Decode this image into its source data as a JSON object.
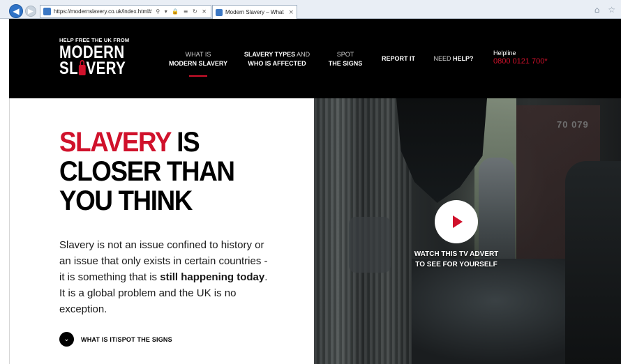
{
  "browser": {
    "back_icon": "back-arrow-icon",
    "forward_icon": "forward-arrow-icon",
    "url": "https://modernslavery.co.uk/index.html#",
    "address_tools": "⚲ ▾ 🔒 ≡ ↻ ✕",
    "tab_title": "Modern Slavery – What it is,...",
    "tab_close": "×",
    "right_icons": "⌂ ☆"
  },
  "logo": {
    "tagline": "HELP FREE THE UK FROM",
    "word1": "MODERN",
    "word2_a": "SL",
    "word2_b": "VERY"
  },
  "nav": {
    "items": [
      {
        "line1": "WHAT IS",
        "line2": "MODERN SLAVERY"
      },
      {
        "line1_bold": "SLAVERY TYPES",
        "line1_light": " AND",
        "line2": "WHO IS AFFECTED"
      },
      {
        "line1": "SPOT",
        "line2": "THE SIGNS"
      },
      {
        "line1": "REPORT IT"
      },
      {
        "line1_light": "NEED ",
        "line1_bold": "HELP?"
      }
    ],
    "helpline_label": "Helpline",
    "helpline_number": "0800 0121 700*"
  },
  "hero": {
    "title_red": "SLAVERY",
    "title_rest1": " IS",
    "title_line2": "CLOSER THAN",
    "title_line3": "YOU THINK",
    "body_part1": "Slavery is not an issue confined to history or an issue that only exists in certain countries - it is something that is ",
    "body_bold": "still happening today",
    "body_part2": ". It is a global problem and the UK is no exception.",
    "cta_icon": "chevron-down-icon",
    "cta_label": "WHAT IS IT/SPOT THE SIGNS"
  },
  "video": {
    "container_number": "70 079",
    "play_icon": "play-icon",
    "watch_line1": "WATCH THIS TV ADVERT",
    "watch_line2": "TO SEE FOR YOURSELF"
  },
  "colors": {
    "brand_red": "#d0112b",
    "header_bg": "#000000"
  }
}
